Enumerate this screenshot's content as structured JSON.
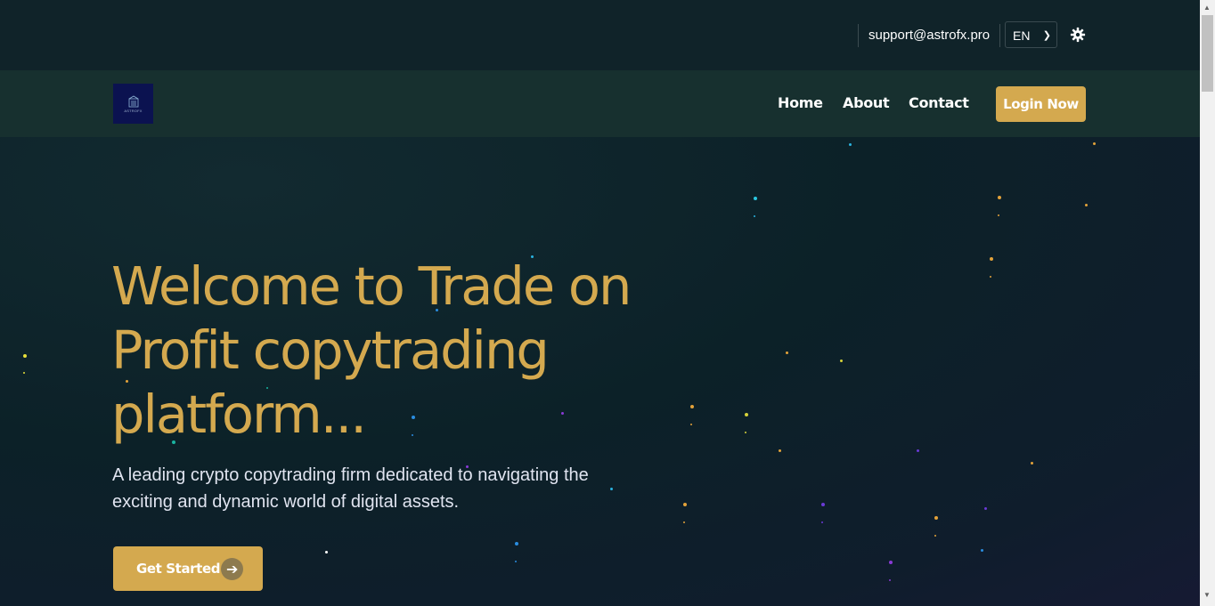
{
  "topbar": {
    "email": "support@astrofx.pro",
    "language": "EN",
    "theme_icon": "gear-icon"
  },
  "navbar": {
    "logo_text": "ASTROFX",
    "links": [
      "Home",
      "About",
      "Contact"
    ],
    "login_label": "Login Now"
  },
  "hero": {
    "title": "Welcome to Trade on Profit copytrading platform...",
    "subtitle": "A leading crypto copytrading firm dedicated to navigating the exciting and dynamic world of digital assets.",
    "cta_label": "Get Started",
    "cta_icon": "arrow-right-icon"
  },
  "colors": {
    "accent": "#d4a94f",
    "topbar_bg": "#102329",
    "navbar_bg": "#17302f",
    "logo_bg": "#0b1250"
  }
}
